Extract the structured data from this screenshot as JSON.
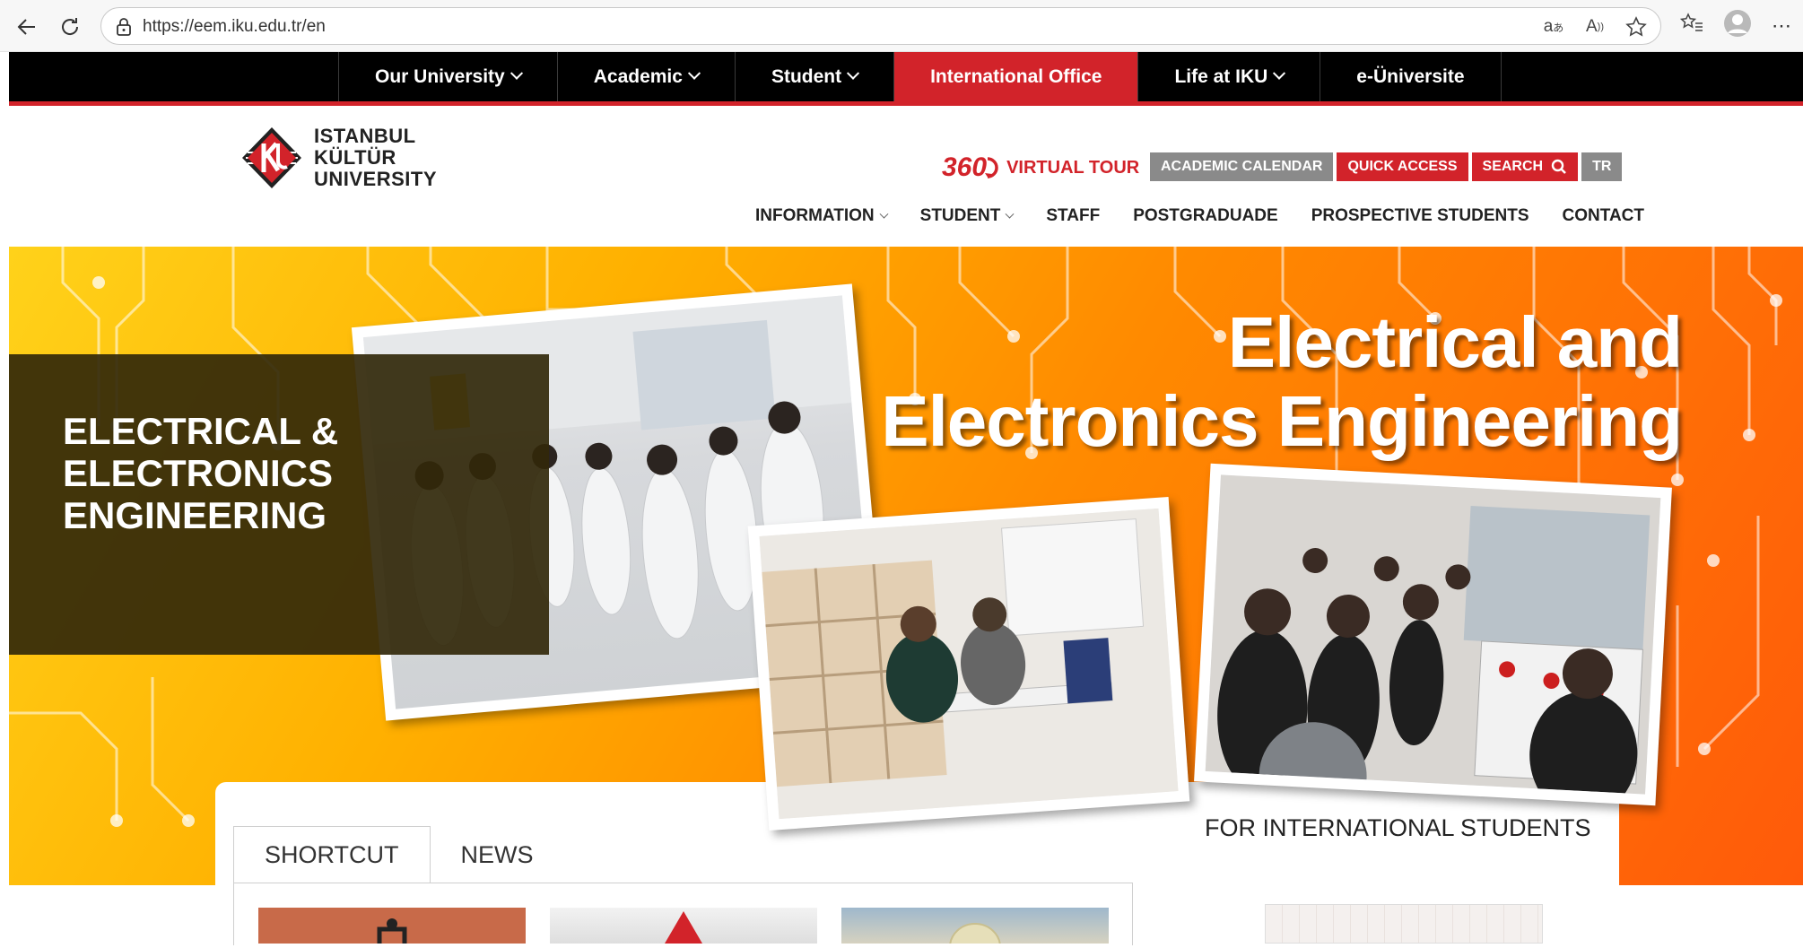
{
  "browser": {
    "url": "https://eem.iku.edu.tr/en"
  },
  "topnav": {
    "items": [
      {
        "label": "Our University",
        "has_dropdown": true,
        "active": false
      },
      {
        "label": "Academic",
        "has_dropdown": true,
        "active": false
      },
      {
        "label": "Student",
        "has_dropdown": true,
        "active": false
      },
      {
        "label": "International Office",
        "has_dropdown": false,
        "active": true
      },
      {
        "label": "Life at IKU",
        "has_dropdown": true,
        "active": false
      },
      {
        "label": "e-Üniversite",
        "has_dropdown": false,
        "active": false
      }
    ]
  },
  "header": {
    "logo_lines": [
      "ISTANBUL",
      "KÜLTÜR",
      "UNIVERSITY"
    ],
    "tour_number": "360",
    "tour_label": "VIRTUAL TOUR",
    "quick_buttons": {
      "academic_calendar": "ACADEMIC CALENDAR",
      "quick_access": "QUICK ACCESS",
      "search": "SEARCH",
      "lang": "TR"
    },
    "subnav": [
      "INFORMATION",
      "STUDENT",
      "STAFF",
      "POSTGRADUADE",
      "PROSPECTIVE STUDENTS",
      "CONTACT"
    ]
  },
  "hero": {
    "box_title": "ELECTRICAL &\nELECTRONICS\nENGINEERING",
    "headline_line1": "Electrical and",
    "headline_line2": "Electronics Engineering"
  },
  "content": {
    "tabs": [
      "SHORTCUT",
      "NEWS"
    ],
    "active_tab": "SHORTCUT",
    "intl_title": "FOR INTERNATIONAL STUDENTS"
  },
  "colors": {
    "brand_red": "#d2232a",
    "nav_black": "#000000",
    "hero_yellow": "#ffd21a",
    "hero_orange": "#ff5a0a"
  }
}
